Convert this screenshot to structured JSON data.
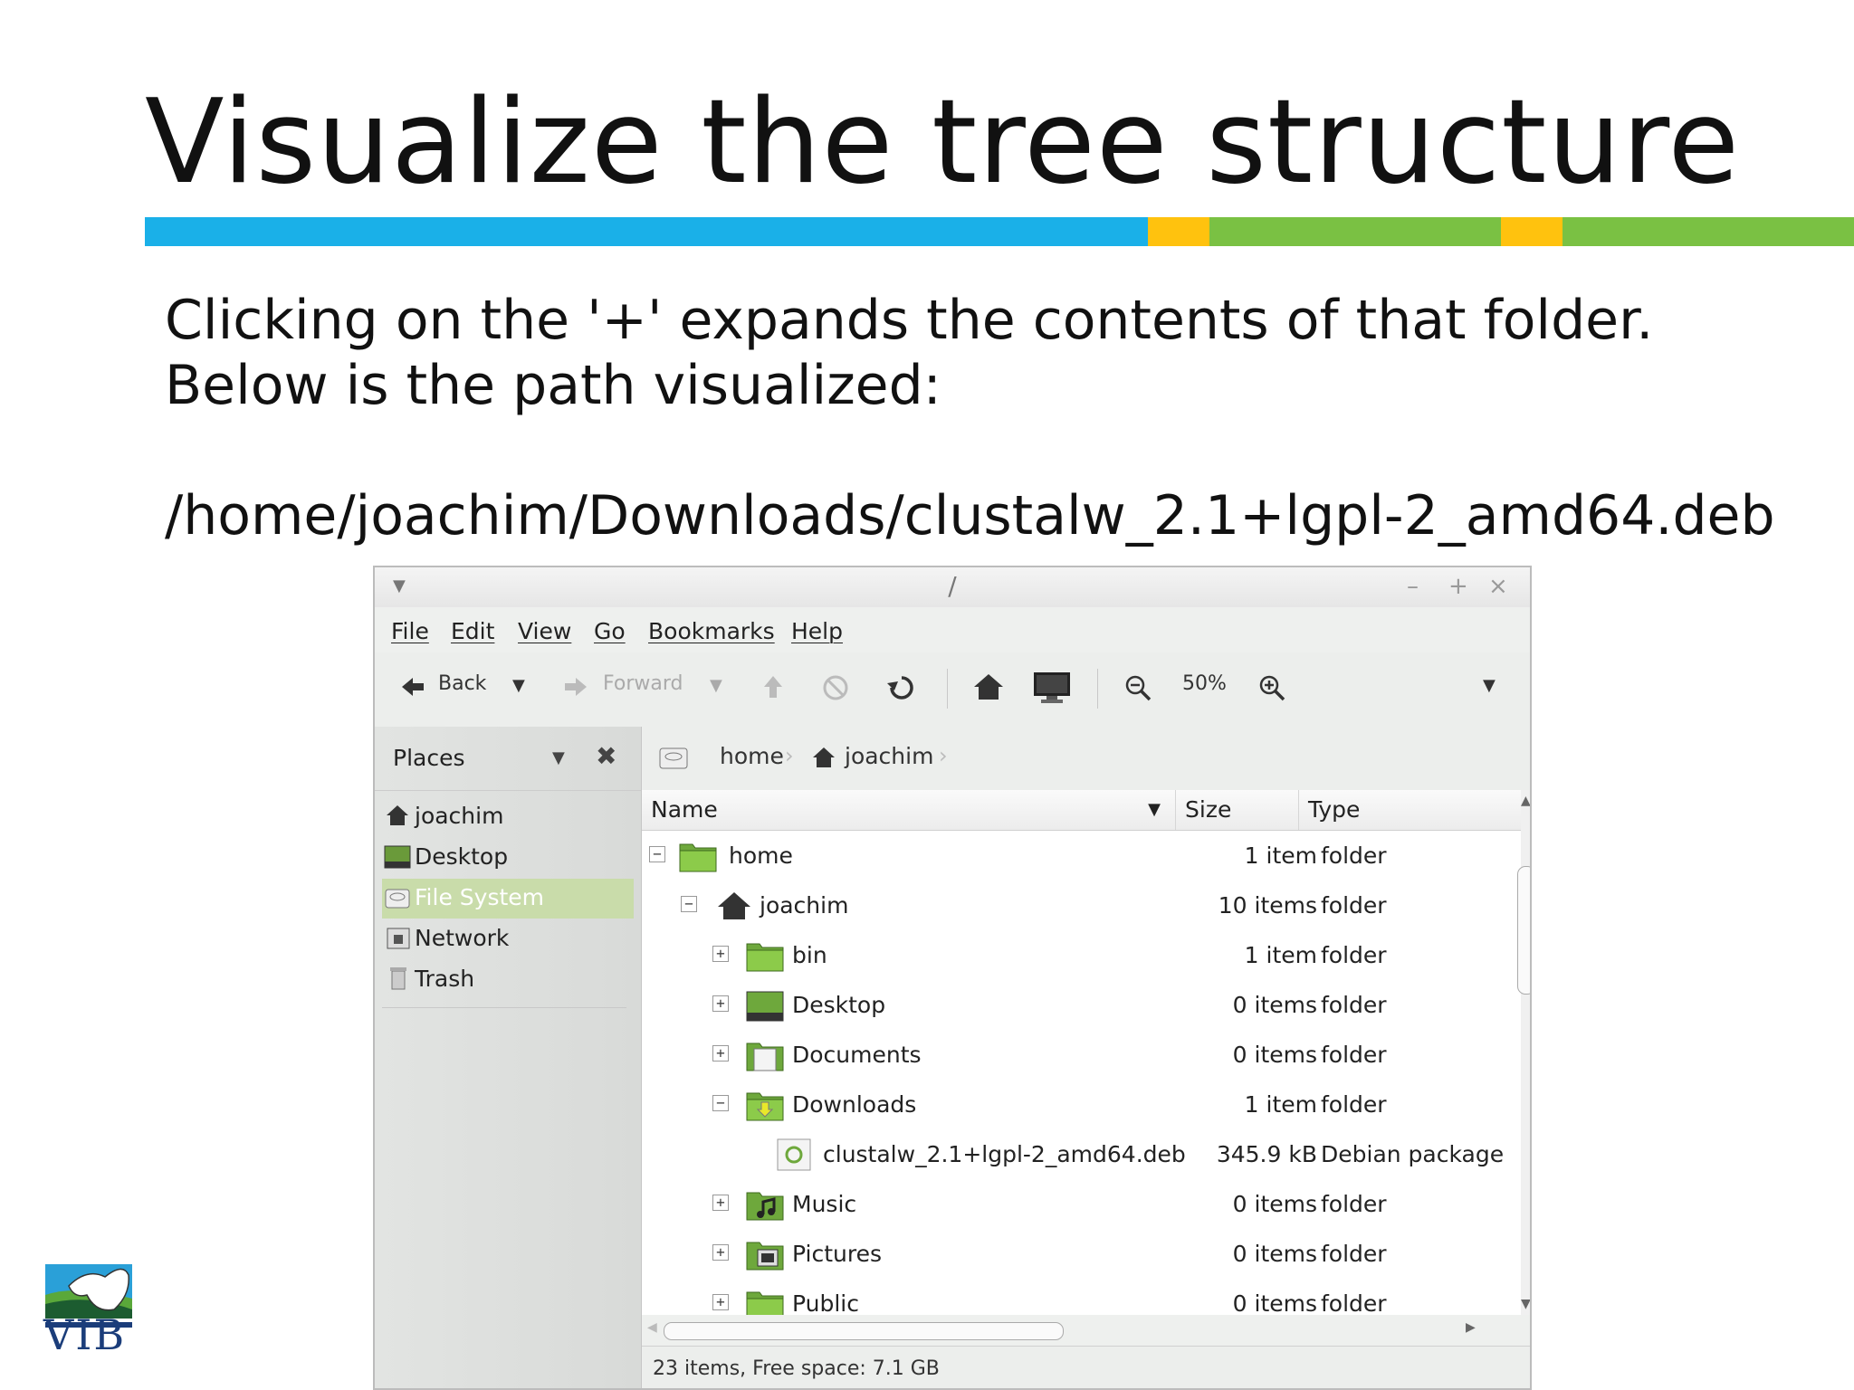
{
  "slide": {
    "title": "Visualize the tree structure",
    "line1": "Clicking on the '+' expands the contents of that folder.",
    "line2": "Below is the path visualized:",
    "path": "/home/joachim/Downloads/clustalw_2.1+lgpl-2_amd64.deb",
    "logo_text": "VIB",
    "colors": {
      "blue": "#1ab0e8",
      "yellow": "#ffc20e",
      "green": "#7ac143"
    }
  },
  "window": {
    "title": "/",
    "menu": [
      "File",
      "Edit",
      "View",
      "Go",
      "Bookmarks",
      "Help"
    ],
    "toolbar": {
      "back": "Back",
      "forward": "Forward",
      "zoom": "50%"
    },
    "sidebar": {
      "header": "Places",
      "items": [
        {
          "label": "joachim",
          "icon": "home-icon"
        },
        {
          "label": "Desktop",
          "icon": "desktop-icon"
        },
        {
          "label": "File System",
          "icon": "drive-icon",
          "selected": true
        },
        {
          "label": "Network",
          "icon": "network-icon"
        },
        {
          "label": "Trash",
          "icon": "trash-icon"
        }
      ]
    },
    "breadcrumbs": [
      "home",
      "joachim"
    ],
    "columns": {
      "name": "Name",
      "size": "Size",
      "type": "Type"
    },
    "rows": [
      {
        "name": "home",
        "size": "1 item",
        "type": "folder",
        "expander": "−"
      },
      {
        "name": "joachim",
        "size": "10 items",
        "type": "folder",
        "expander": "−"
      },
      {
        "name": "bin",
        "size": "1 item",
        "type": "folder",
        "expander": "+"
      },
      {
        "name": "Desktop",
        "size": "0 items",
        "type": "folder",
        "expander": "+"
      },
      {
        "name": "Documents",
        "size": "0 items",
        "type": "folder",
        "expander": "+"
      },
      {
        "name": "Downloads",
        "size": "1 item",
        "type": "folder",
        "expander": "−"
      },
      {
        "name": "clustalw_2.1+lgpl-2_amd64.deb",
        "size": "345.9 kB",
        "type": "Debian package",
        "expander": ""
      },
      {
        "name": "Music",
        "size": "0 items",
        "type": "folder",
        "expander": "+"
      },
      {
        "name": "Pictures",
        "size": "0 items",
        "type": "folder",
        "expander": "+"
      },
      {
        "name": "Public",
        "size": "0 items",
        "type": "folder",
        "expander": "+"
      }
    ],
    "status": "23 items, Free space: 7.1 GB"
  }
}
